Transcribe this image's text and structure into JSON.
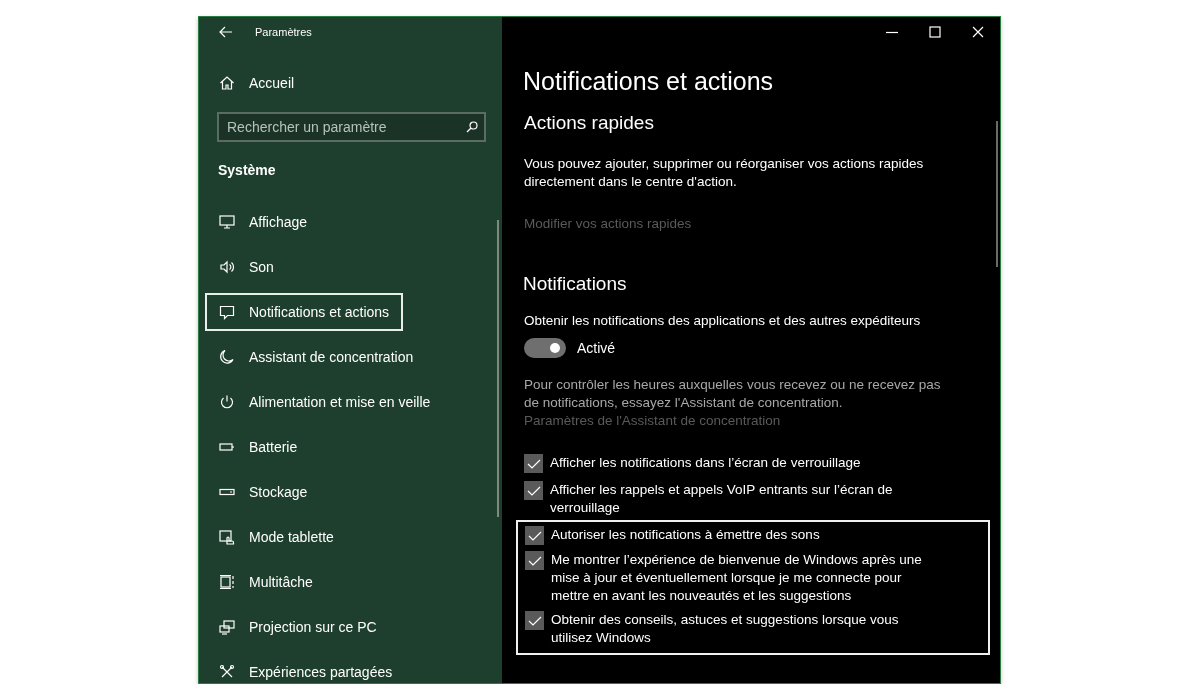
{
  "window": {
    "title": "Paramètres"
  },
  "sidebar": {
    "home": "Accueil",
    "search": {
      "placeholder": "Rechercher un paramètre"
    },
    "section": "Système",
    "items": [
      {
        "label": "Affichage",
        "selected": false
      },
      {
        "label": "Son",
        "selected": false
      },
      {
        "label": "Notifications et actions",
        "selected": true
      },
      {
        "label": "Assistant de concentration",
        "selected": false
      },
      {
        "label": "Alimentation et mise en veille",
        "selected": false
      },
      {
        "label": "Batterie",
        "selected": false
      },
      {
        "label": "Stockage",
        "selected": false
      },
      {
        "label": "Mode tablette",
        "selected": false
      },
      {
        "label": "Multitâche",
        "selected": false
      },
      {
        "label": "Projection sur ce PC",
        "selected": false
      },
      {
        "label": "Expériences partagées",
        "selected": false
      }
    ]
  },
  "page": {
    "title": "Notifications et actions",
    "quick_actions": {
      "heading": "Actions rapides",
      "description": "Vous pouvez ajouter, supprimer ou réorganiser vos actions rapides directement dans le centre d'action.",
      "link": {
        "label": "Modifier vos actions rapides",
        "disabled": true
      }
    },
    "notifications": {
      "heading": "Notifications",
      "toggle_label": "Obtenir les notifications des applications et des autres expéditeurs",
      "toggle": {
        "on": true,
        "state_text": "Activé"
      },
      "focus_text": "Pour contrôler les heures auxquelles vous recevez ou ne recevez pas de notifications, essayez l'Assistant de concentration.",
      "focus_link": {
        "label": "Paramètres de l'Assistant de concentration",
        "disabled": true
      },
      "checkboxes": [
        {
          "label": "Afficher les notifications dans l’écran de verrouillage",
          "checked": true,
          "highlighted": false
        },
        {
          "label": "Afficher les rappels et appels VoIP entrants sur l’écran de verrouillage",
          "checked": true,
          "highlighted": false
        },
        {
          "label": "Autoriser les notifications à émettre des sons",
          "checked": true,
          "highlighted": true
        },
        {
          "label": "Me montrer l’expérience de bienvenue de Windows après une mise à jour et éventuellement lorsque je me connecte pour mettre en avant les nouveautés et les suggestions",
          "checked": true,
          "highlighted": true
        },
        {
          "label": "Obtenir des conseils, astuces et suggestions lorsque vous utilisez Windows",
          "checked": true,
          "highlighted": true
        }
      ]
    }
  }
}
